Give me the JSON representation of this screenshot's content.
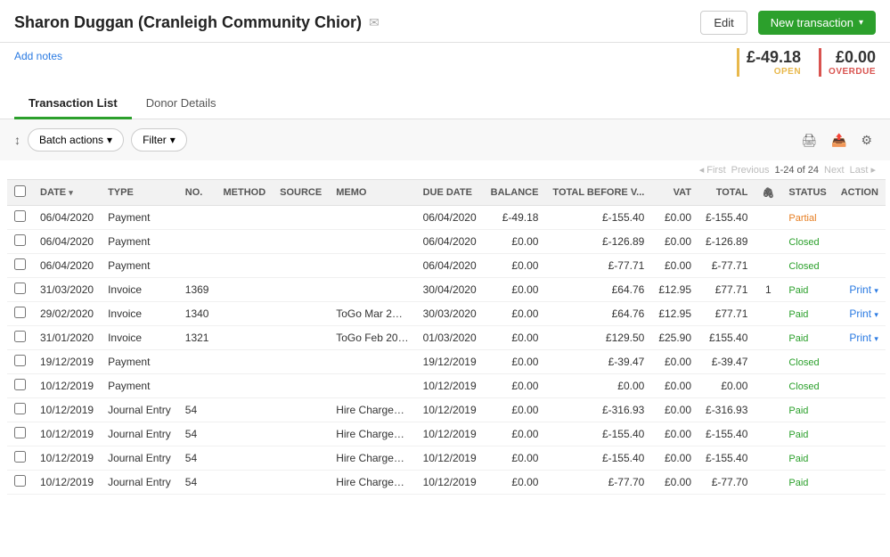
{
  "header": {
    "title": "Sharon Duggan (Cranleigh Community Chior)",
    "email_icon": "✉",
    "edit_label": "Edit",
    "new_transaction_label": "New transaction",
    "new_transaction_arrow": "▾"
  },
  "summary": {
    "open_amount": "£-49.18",
    "open_label": "OPEN",
    "overdue_amount": "£0.00",
    "overdue_label": "OVERDUE"
  },
  "add_notes_label": "Add notes",
  "tabs": [
    {
      "label": "Transaction List",
      "active": true
    },
    {
      "label": "Donor Details",
      "active": false
    }
  ],
  "toolbar": {
    "batch_actions_label": "Batch actions",
    "batch_actions_arrow": "▾",
    "filter_label": "Filter",
    "filter_arrow": "▾",
    "sort_icon": "↕"
  },
  "pagination": {
    "first_label": "First",
    "prev_label": "Previous",
    "range_label": "1-24 of 24",
    "next_label": "Next",
    "last_label": "Last ›"
  },
  "table": {
    "columns": [
      "",
      "DATE ▾",
      "TYPE",
      "NO.",
      "METHOD",
      "SOURCE",
      "MEMO",
      "DUE DATE",
      "BALANCE",
      "TOTAL BEFORE V...",
      "VAT",
      "TOTAL",
      "🖇",
      "STATUS",
      "ACTION"
    ],
    "rows": [
      {
        "date": "06/04/2020",
        "type": "Payment",
        "no": "",
        "method": "",
        "source": "",
        "memo": "",
        "due_date": "06/04/2020",
        "balance": "£-49.18",
        "total_before_vat": "£-155.40",
        "vat": "£0.00",
        "total": "£-155.40",
        "attach": "",
        "status": "Partial",
        "status_class": "status-partial",
        "action": "",
        "action_link": false
      },
      {
        "date": "06/04/2020",
        "type": "Payment",
        "no": "",
        "method": "",
        "source": "",
        "memo": "",
        "due_date": "06/04/2020",
        "balance": "£0.00",
        "total_before_vat": "£-126.89",
        "vat": "£0.00",
        "total": "£-126.89",
        "attach": "",
        "status": "Closed",
        "status_class": "status-closed",
        "action": "",
        "action_link": false
      },
      {
        "date": "06/04/2020",
        "type": "Payment",
        "no": "",
        "method": "",
        "source": "",
        "memo": "",
        "due_date": "06/04/2020",
        "balance": "£0.00",
        "total_before_vat": "£-77.71",
        "vat": "£0.00",
        "total": "£-77.71",
        "attach": "",
        "status": "Closed",
        "status_class": "status-closed",
        "action": "",
        "action_link": false
      },
      {
        "date": "31/03/2020",
        "type": "Invoice",
        "no": "1369",
        "method": "",
        "source": "",
        "memo": "",
        "due_date": "30/04/2020",
        "balance": "£0.00",
        "total_before_vat": "£64.76",
        "vat": "£12.95",
        "total": "£77.71",
        "attach": "1",
        "status": "Paid",
        "status_class": "status-paid",
        "action": "Print",
        "action_link": true
      },
      {
        "date": "29/02/2020",
        "type": "Invoice",
        "no": "1340",
        "method": "",
        "source": "",
        "memo": "ToGo Mar 2…",
        "due_date": "30/03/2020",
        "balance": "£0.00",
        "total_before_vat": "£64.76",
        "vat": "£12.95",
        "total": "£77.71",
        "attach": "",
        "status": "Paid",
        "status_class": "status-paid",
        "action": "Print",
        "action_link": true
      },
      {
        "date": "31/01/2020",
        "type": "Invoice",
        "no": "1321",
        "method": "",
        "source": "",
        "memo": "ToGo Feb 20…",
        "due_date": "01/03/2020",
        "balance": "£0.00",
        "total_before_vat": "£129.50",
        "vat": "£25.90",
        "total": "£155.40",
        "attach": "",
        "status": "Paid",
        "status_class": "status-paid",
        "action": "Print",
        "action_link": true
      },
      {
        "date": "19/12/2019",
        "type": "Payment",
        "no": "",
        "method": "",
        "source": "",
        "memo": "",
        "due_date": "19/12/2019",
        "balance": "£0.00",
        "total_before_vat": "£-39.47",
        "vat": "£0.00",
        "total": "£-39.47",
        "attach": "",
        "status": "Closed",
        "status_class": "status-closed",
        "action": "",
        "action_link": false
      },
      {
        "date": "10/12/2019",
        "type": "Payment",
        "no": "",
        "method": "",
        "source": "",
        "memo": "",
        "due_date": "10/12/2019",
        "balance": "£0.00",
        "total_before_vat": "£0.00",
        "vat": "£0.00",
        "total": "£0.00",
        "attach": "",
        "status": "Closed",
        "status_class": "status-closed",
        "action": "",
        "action_link": false
      },
      {
        "date": "10/12/2019",
        "type": "Journal Entry",
        "no": "54",
        "method": "",
        "source": "",
        "memo": "Hire Charge…",
        "due_date": "10/12/2019",
        "balance": "£0.00",
        "total_before_vat": "£-316.93",
        "vat": "£0.00",
        "total": "£-316.93",
        "attach": "",
        "status": "Paid",
        "status_class": "status-paid",
        "action": "",
        "action_link": false
      },
      {
        "date": "10/12/2019",
        "type": "Journal Entry",
        "no": "54",
        "method": "",
        "source": "",
        "memo": "Hire Charge…",
        "due_date": "10/12/2019",
        "balance": "£0.00",
        "total_before_vat": "£-155.40",
        "vat": "£0.00",
        "total": "£-155.40",
        "attach": "",
        "status": "Paid",
        "status_class": "status-paid",
        "action": "",
        "action_link": false
      },
      {
        "date": "10/12/2019",
        "type": "Journal Entry",
        "no": "54",
        "method": "",
        "source": "",
        "memo": "Hire Charge…",
        "due_date": "10/12/2019",
        "balance": "£0.00",
        "total_before_vat": "£-155.40",
        "vat": "£0.00",
        "total": "£-155.40",
        "attach": "",
        "status": "Paid",
        "status_class": "status-paid",
        "action": "",
        "action_link": false
      },
      {
        "date": "10/12/2019",
        "type": "Journal Entry",
        "no": "54",
        "method": "",
        "source": "",
        "memo": "Hire Charge…",
        "due_date": "10/12/2019",
        "balance": "£0.00",
        "total_before_vat": "£-77.70",
        "vat": "£0.00",
        "total": "£-77.70",
        "attach": "",
        "status": "Paid",
        "status_class": "status-paid",
        "action": "",
        "action_link": false
      }
    ]
  }
}
